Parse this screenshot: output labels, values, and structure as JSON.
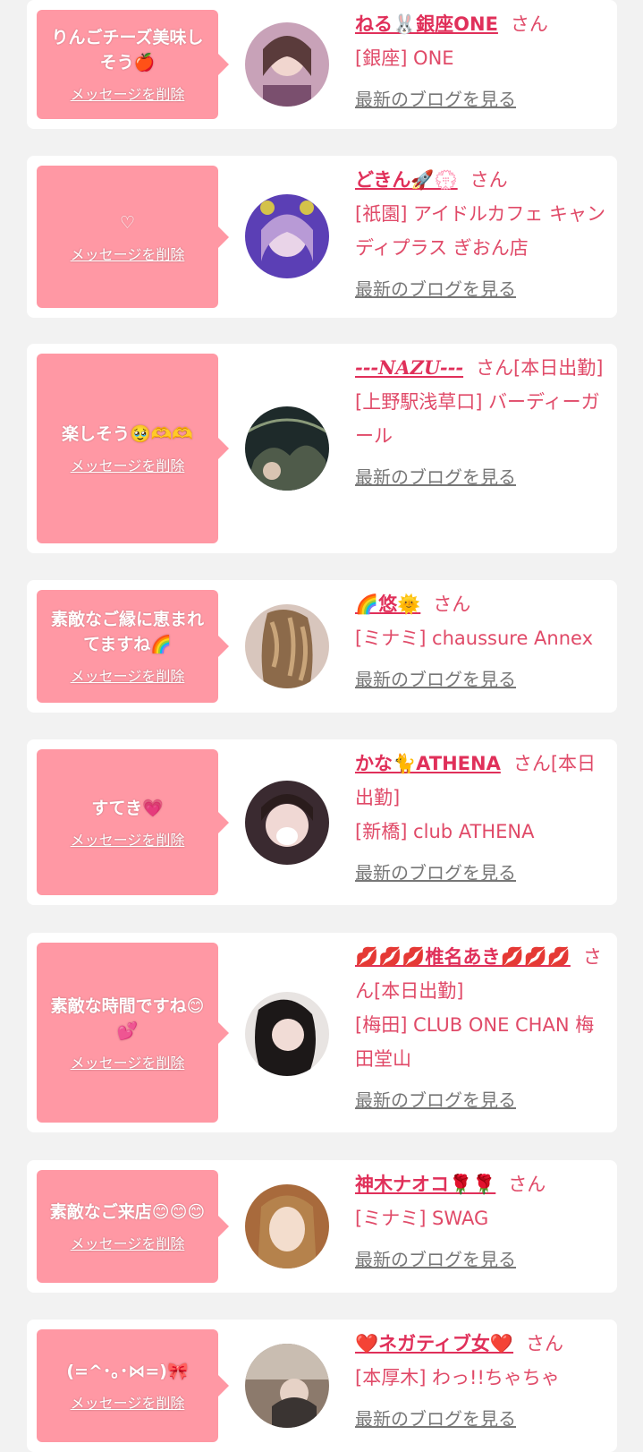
{
  "delete_label": "メッセージを削除",
  "blog_label": "最新のブログを見る",
  "colors": {
    "bubble": "#ff98a4",
    "name": "#e0305a",
    "text": "#e04a68",
    "link_gray": "#777777",
    "page_bg": "#f2f2f2"
  },
  "items": [
    {
      "message": "りんごチーズ美味しそう🍎",
      "name": "ねる🐰銀座ONE",
      "honorific": "さん",
      "shop": "[銀座] ONE",
      "avatar_icon": "avatar-photo"
    },
    {
      "message": "♡",
      "name": "どきん🚀💮",
      "honorific": "さん",
      "shop": "[祇園] アイドルカフェ キャンディプラス ぎおん店",
      "avatar_icon": "avatar-photo"
    },
    {
      "message": "楽しそう🥹🫶🫶",
      "name": "---NAZU---",
      "honorific": "さん[本日出勤]",
      "shop": "[上野駅浅草口] バーディーガール",
      "avatar_icon": "avatar-photo"
    },
    {
      "message": "素敵なご縁に恵まれてますね🌈",
      "name": "🌈悠🌞",
      "honorific": "さん",
      "shop": "[ミナミ] chaussure Annex",
      "avatar_icon": "avatar-photo"
    },
    {
      "message": "すてき💗",
      "name": "かな🐈ATHENA",
      "honorific": "さん[本日出勤]",
      "shop": "[新橋] club ATHENA",
      "avatar_icon": "avatar-photo"
    },
    {
      "message": "素敵な時間ですね😊💕",
      "name": "💋💋💋椎名あき💋💋💋",
      "honorific": "さん[本日出勤]",
      "shop": "[梅田] CLUB ONE CHAN 梅田堂山",
      "avatar_icon": "avatar-photo"
    },
    {
      "message": "素敵なご来店😊😊😊",
      "name": "神木ナオコ🌹🌹",
      "honorific": "さん",
      "shop": "[ミナミ] SWAG",
      "avatar_icon": "avatar-photo"
    },
    {
      "message": "(=^･｡･⋈=)🎀",
      "name": "❤️ネガティブ女❤️",
      "honorific": "さん",
      "shop": "[本厚木] わっ!!ちゃちゃ",
      "avatar_icon": "avatar-photo"
    }
  ]
}
